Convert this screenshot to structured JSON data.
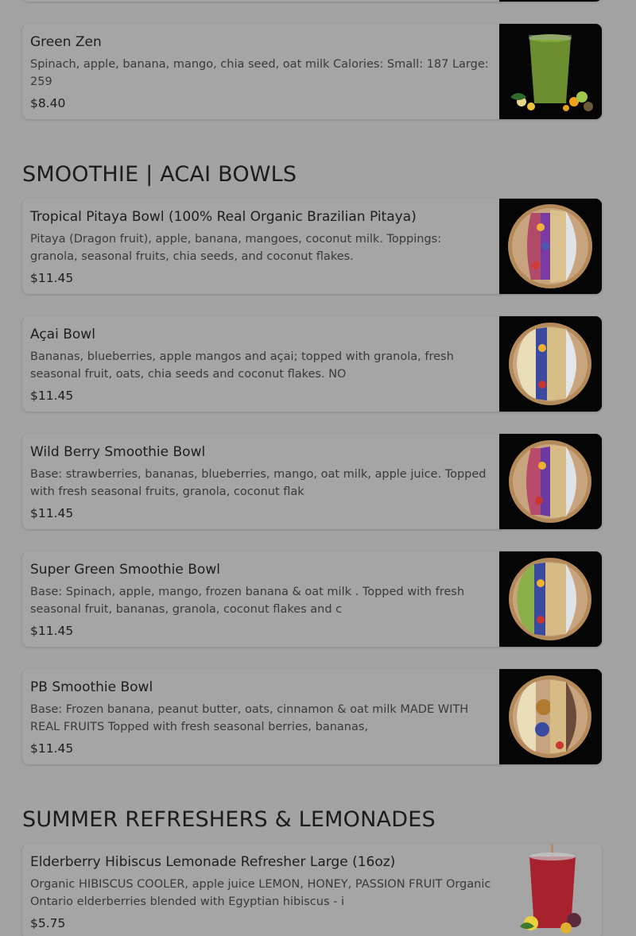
{
  "sections": {
    "smoothie_bowls": {
      "title": "SMOOTHIE | ACAI BOWLS"
    },
    "refreshers": {
      "title": "SUMMER REFRESHERS & LEMONADES"
    }
  },
  "items": {
    "green_zen": {
      "name": "Green Zen",
      "description": "Spinach, apple, banana, mango, chia seed, oat milk Calories: Small: 187 Large: 259",
      "price": "$8.40",
      "image_icon": "green-smoothie-image"
    },
    "tropical_pitaya": {
      "name": "Tropical Pitaya Bowl (100% Real Organic Brazilian Pitaya)",
      "description": "Pitaya (Dragon fruit), apple, banana, mangoes, coconut milk. Toppings: granola, seasonal fruits, chia seeds, and coconut flakes.",
      "price": "$11.45",
      "image_icon": "acai-bowl-image"
    },
    "acai_bowl": {
      "name": "Açai Bowl",
      "description": "Bananas, blueberries, apple mangos and açai; topped with granola, fresh seasonal fruit, oats, chia seeds and coconut flakes. NO",
      "price": "$11.45",
      "image_icon": "acai-bowl-image"
    },
    "wild_berry": {
      "name": "Wild Berry Smoothie Bowl",
      "description": "Base: strawberries, bananas, blueberries, mango, oat milk, apple juice. Topped with fresh seasonal fruits, granola, coconut flak",
      "price": "$11.45",
      "image_icon": "acai-bowl-image"
    },
    "super_green": {
      "name": "Super Green Smoothie Bowl",
      "description": "Base: Spinach, apple, mango, frozen banana & oat milk . Topped with fresh seasonal fruit, bananas, granola, coconut flakes and c",
      "price": "$11.45",
      "image_icon": "acai-bowl-image"
    },
    "pb_bowl": {
      "name": "PB Smoothie Bowl",
      "description": "Base: Frozen banana, peanut butter, oats, cinnamon & oat milk MADE WITH REAL FRUITS Topped with fresh seasonal berries, bananas,",
      "price": "$11.45",
      "image_icon": "pb-bowl-image"
    },
    "elderberry": {
      "name": "Elderberry Hibiscus Lemonade Refresher Large (16oz)",
      "description": "Organic HIBISCUS COOLER, apple juice LEMON, HONEY, PASSION FRUIT Organic Ontario elderberries blended with Egyptian hibiscus - i",
      "price": "$5.75",
      "image_icon": "hibiscus-drink-image"
    }
  },
  "colors": {
    "overlay_background": "#a3a3a3",
    "card_background": "#a5a5a5",
    "thumb_background": "#050505"
  }
}
